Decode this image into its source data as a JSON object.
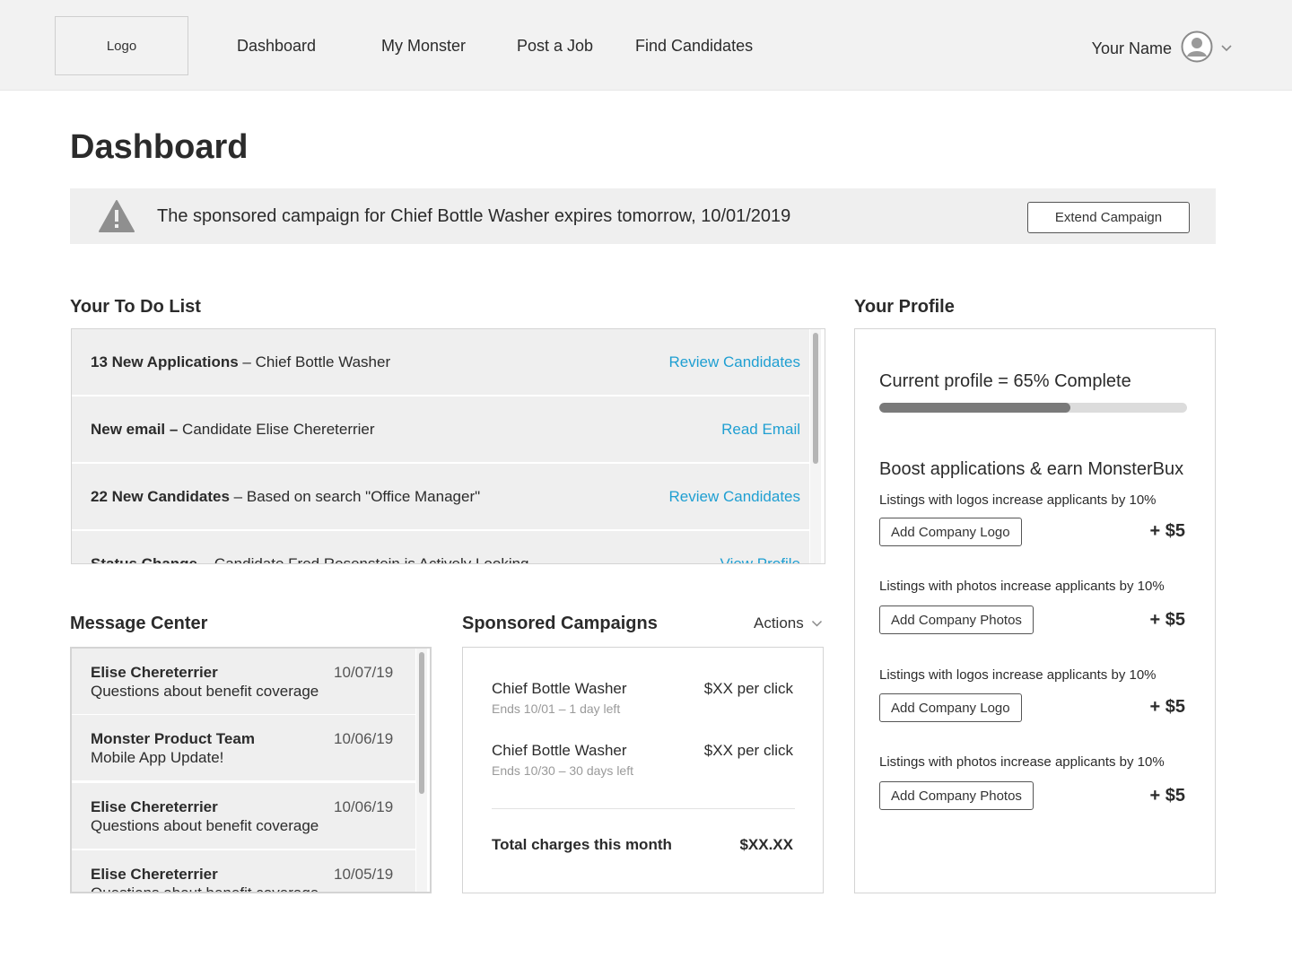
{
  "nav": {
    "logo": "Logo",
    "items": [
      "Dashboard",
      "My Monster",
      "Post a Job",
      "Find Candidates"
    ],
    "user_name": "Your Name"
  },
  "page_title": "Dashboard",
  "alert": {
    "message": "The sponsored campaign for Chief Bottle Washer expires tomorrow, 10/01/2019",
    "button": "Extend Campaign"
  },
  "todo": {
    "heading": "Your To Do List",
    "items": [
      {
        "bold": "13 New Applications",
        "rest": " – Chief Bottle Washer",
        "action": "Review Candidates"
      },
      {
        "bold": "New email –",
        "rest": " Candidate Elise Chereterrier",
        "action": "Read Email"
      },
      {
        "bold": "22 New Candidates",
        "rest": " – Based on search \"Office Manager\"",
        "action": "Review Candidates"
      },
      {
        "bold": "Status Change",
        "rest": " – Candidate Fred Rosenstein is Actively Looking",
        "action": "View Profile"
      }
    ]
  },
  "messages": {
    "heading": "Message Center",
    "items": [
      {
        "from": "Elise Chereterrier",
        "subject": "Questions about benefit coverage",
        "date": "10/07/19"
      },
      {
        "from": "Monster Product Team",
        "subject": "Mobile App Update!",
        "date": "10/06/19"
      },
      {
        "from": "Elise Chereterrier",
        "subject": "Questions about benefit coverage",
        "date": "10/06/19"
      },
      {
        "from": "Elise Chereterrier",
        "subject": "Questions about benefit coverage",
        "date": "10/05/19"
      }
    ]
  },
  "campaigns": {
    "heading": "Sponsored Campaigns",
    "actions": "Actions",
    "items": [
      {
        "name": "Chief Bottle Washer",
        "ends": "Ends 10/01 – 1 day left",
        "price": "$XX per click"
      },
      {
        "name": "Chief Bottle Washer",
        "ends": "Ends 10/30 – 30 days left",
        "price": "$XX per click"
      }
    ],
    "total_label": "Total charges this month",
    "total_value": "$XX.XX"
  },
  "profile": {
    "heading": "Your Profile",
    "status": "Current profile = 65% Complete",
    "progress": 0.62,
    "boost_heading": "Boost applications & earn MonsterBux",
    "boosts": [
      {
        "desc": "Listings with logos increase applicants by 10%",
        "button": "Add Company Logo",
        "price": "+ $5"
      },
      {
        "desc": "Listings with photos increase applicants by 10%",
        "button": "Add Company Photos",
        "price": "+ $5"
      },
      {
        "desc": "Listings with logos increase applicants by 10%",
        "button": "Add Company Logo",
        "price": "+ $5"
      },
      {
        "desc": "Listings with photos increase applicants by 10%",
        "button": "Add Company Photos",
        "price": "+ $5"
      }
    ]
  },
  "colors": {
    "link": "#1f9fd2",
    "row_bg": "#efefef",
    "progress_fill": "#7a7a7a"
  }
}
